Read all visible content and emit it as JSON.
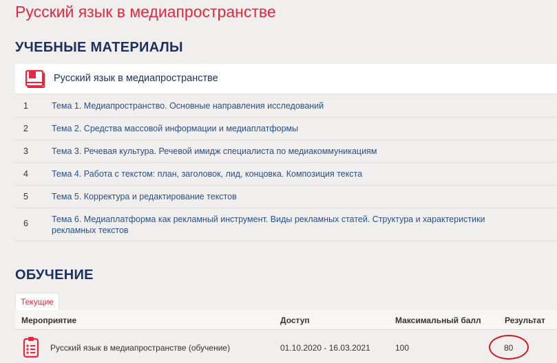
{
  "page_title": "Русский язык в медиапространстве",
  "materials": {
    "heading": "УЧЕБНЫЕ МАТЕРИАЛЫ",
    "course_title": "Русский язык в медиапространстве",
    "icon": "book-icon",
    "topics": [
      {
        "num": "1",
        "title": "Тема 1. Медиапространство. Основные направления исследований"
      },
      {
        "num": "2",
        "title": "Тема 2. Средства массовой информации и медиаплатформы"
      },
      {
        "num": "3",
        "title": "Тема 3. Речевая культура. Речевой имидж специалиста по медиакоммуникациям"
      },
      {
        "num": "4",
        "title": "Тема 4. Работа с текстом: план, заголовок, лид, концовка. Композиция текста"
      },
      {
        "num": "5",
        "title": "Тема 5. Корректура и редактирование текстов"
      },
      {
        "num": "6",
        "title": "Тема 6. Медиаплатформа как рекламный инструмент. Виды рекламных статей. Структура и характеристики рекламных текстов"
      }
    ]
  },
  "training": {
    "heading": "ОБУЧЕНИЕ",
    "tab_label": "Текущие",
    "columns": {
      "event": "Мероприятие",
      "access": "Доступ",
      "max_score": "Максимальный балл",
      "result": "Результат"
    },
    "rows": [
      {
        "icon": "clipboard-icon",
        "event": "Русский язык в медиапространстве (обучение)",
        "access": "01.10.2020 - 16.03.2021",
        "max_score": "100",
        "result": "80"
      }
    ]
  },
  "colors": {
    "title_red": "#e5273f",
    "heading_navy": "#1c2f5e",
    "link_blue": "#2a4f85",
    "annotation_red": "#d8151c",
    "background": "#f1efee"
  }
}
